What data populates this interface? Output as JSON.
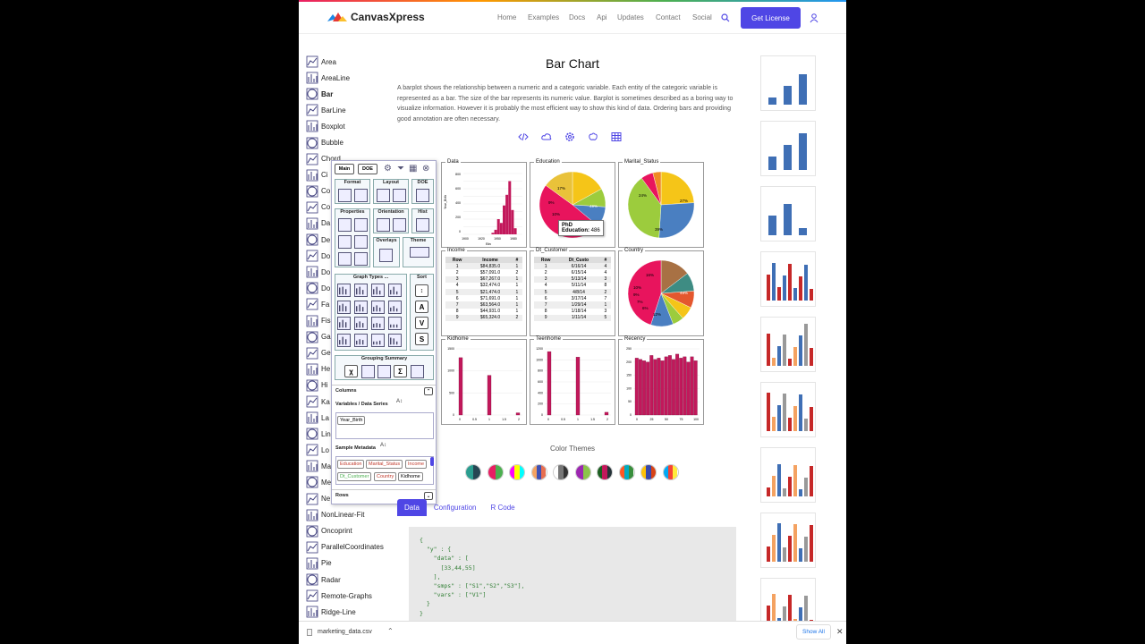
{
  "nav": {
    "logo_text": "CanvasXpress",
    "links": [
      "Home",
      "Examples",
      "Docs",
      "Api",
      "Updates",
      "Contact",
      "Social"
    ],
    "cta": "Get License"
  },
  "sidebar": {
    "items": [
      "Area",
      "AreaLine",
      "Bar",
      "BarLine",
      "Boxplot",
      "Bubble",
      "Chord",
      "Ci",
      "Co",
      "Co",
      "Da",
      "De",
      "Do",
      "Do",
      "Do",
      "Fa",
      "Fis",
      "Ga",
      "Ge",
      "He",
      "Hi",
      "Ka",
      "La",
      "Lin",
      "Lo",
      "Ma",
      "Me",
      "Ne",
      "NonLinear-Fit",
      "Oncoprint",
      "ParallelCoordinates",
      "Pie",
      "Radar",
      "Remote-Graphs",
      "Ridge-Line"
    ],
    "active": "Bar"
  },
  "main": {
    "title": "Bar Chart",
    "description": "A barplot shows the relationship between a numeric and a categoric variable. Each entity of the categoric variable is represented as a bar. The size of the bar represents its numeric value. Barplot is sometimes described as a boring way to visualize information. However it is probably the most efficient way to show this kind of data. Ordering bars and providing good annotation are often necessary.",
    "icons": [
      "code-icon",
      "cloud-icon",
      "gear-icon",
      "brain-icon",
      "table-icon"
    ]
  },
  "dashboard": {
    "panels": [
      {
        "title": "Data"
      },
      {
        "title": "Education"
      },
      {
        "title": "Marital_Status"
      },
      {
        "title": "Income"
      },
      {
        "title": "Dt_Customer"
      },
      {
        "title": "Country"
      },
      {
        "title": "Kidhome"
      },
      {
        "title": "Teenhome"
      },
      {
        "title": "Recency"
      }
    ],
    "data_hist": {
      "xlabel": "Bin",
      "ylabel": "Year_Birth",
      "xticks": [
        "1900",
        "1920",
        "1950",
        "1980"
      ],
      "yticks": [
        "800",
        "600",
        "400",
        "200",
        "0"
      ]
    },
    "pie_labels": {
      "education": [
        "17%",
        "9%",
        "10%",
        "49%"
      ],
      "marital": [
        "24%",
        "27%",
        "39%"
      ],
      "country": [
        "16%",
        "10%",
        "9%",
        "7%",
        "6%",
        "12%",
        "49%"
      ]
    },
    "income_table": {
      "headers": [
        "Row",
        "Income",
        "#"
      ],
      "rows": [
        [
          "1",
          "$84,835.0",
          "1"
        ],
        [
          "2",
          "$57,091.0",
          "2"
        ],
        [
          "3",
          "$67,267.0",
          "1"
        ],
        [
          "4",
          "$32,474.0",
          "1"
        ],
        [
          "5",
          "$21,474.0",
          "1"
        ],
        [
          "6",
          "$71,691.0",
          "1"
        ],
        [
          "7",
          "$63,564.0",
          "1"
        ],
        [
          "8",
          "$44,931.0",
          "1"
        ],
        [
          "9",
          "$65,324.0",
          "2"
        ]
      ]
    },
    "dt_table": {
      "headers": [
        "Row",
        "Dt_Custo",
        "#"
      ],
      "rows": [
        [
          "1",
          "6/16/14",
          "4"
        ],
        [
          "2",
          "6/15/14",
          "4"
        ],
        [
          "3",
          "5/13/14",
          "3"
        ],
        [
          "4",
          "5/11/14",
          "8"
        ],
        [
          "5",
          "4/8/14",
          "2"
        ],
        [
          "6",
          "3/17/14",
          "7"
        ],
        [
          "7",
          "1/29/14",
          "1"
        ],
        [
          "8",
          "1/18/14",
          "3"
        ],
        [
          "9",
          "1/11/14",
          "5"
        ]
      ]
    },
    "kid_ticks": {
      "x": [
        "0",
        "0.5",
        "1",
        "1.5",
        "2"
      ],
      "y": [
        "1500",
        "1000",
        "500",
        "0"
      ]
    },
    "teen_ticks": {
      "x": [
        "0",
        "0.5",
        "1",
        "1.5",
        "2"
      ],
      "y": [
        "1200",
        "1000",
        "800",
        "600",
        "400",
        "200",
        "0"
      ]
    },
    "recency_ticks": {
      "x": [
        "0",
        "25",
        "50",
        "75",
        "100"
      ],
      "y": [
        "250",
        "200",
        "150",
        "100",
        "50",
        "0"
      ]
    },
    "tooltip": {
      "line1": "PhD",
      "line2_label": "Education:",
      "line2_value": "486"
    }
  },
  "panel": {
    "tabs": [
      "Main",
      "DOE"
    ],
    "groups": [
      "Format",
      "Layout",
      "DOE",
      "Properties",
      "Orientation",
      "Hist",
      "Overlays",
      "Theme",
      "Graph Types ...",
      "Sort",
      "Grouping Summary"
    ],
    "sort_letters": [
      "A",
      "V",
      "S"
    ],
    "columns_label": "Columns",
    "variables_label": "Variables / Data Series",
    "variable_chip": "Year_Birth",
    "sample_metadata_label": "Sample Metadata",
    "metadata_chips": [
      "Education",
      "Marital_Status",
      "Income",
      "Dt_Customer",
      "Country",
      "Kidhome"
    ],
    "rows_label": "Rows"
  },
  "themes": {
    "label": "Color Themes",
    "swatches": [
      [
        "#2a9d8f",
        "#264653"
      ],
      [
        "#e91e63",
        "#4caf50"
      ],
      [
        "#ff00ff",
        "#ffff00",
        "#00ffff"
      ],
      [
        "#f4a261",
        "#3f51b5",
        "#e76f51"
      ],
      [
        "#ffffff",
        "#777777",
        "#333333"
      ],
      [
        "#9c27b0",
        "#8bc34a"
      ],
      [
        "#1b5e20",
        "#c2185b",
        "#263238"
      ],
      [
        "#ff5722",
        "#00acc1",
        "#388e3c"
      ],
      [
        "#ffc107",
        "#3949ab",
        "#d84315"
      ],
      [
        "#03a9f4",
        "#f44336",
        "#ffeb3b"
      ]
    ]
  },
  "bottom_tabs": {
    "items": [
      "Data",
      "Configuration",
      "R Code"
    ],
    "active": "Data"
  },
  "code": "{\n  \"y\" : {\n    \"data\" : [\n      [33,44,55]\n    ],\n    \"smps\" : [\"S1\",\"S2\",\"S3\"],\n    \"vars\" : [\"V1\"]\n  }\n}",
  "download": {
    "file": "marketing_data.csv",
    "show_all": "Show All"
  },
  "chart_data": [
    {
      "type": "bar",
      "panel": "Data",
      "categories": [
        "1900",
        "1920",
        "1950",
        "1980"
      ],
      "x": [
        1940,
        1945,
        1950,
        1955,
        1960,
        1965,
        1970,
        1975,
        1980
      ],
      "values": [
        20,
        60,
        200,
        150,
        380,
        520,
        700,
        320,
        80
      ],
      "ylim": [
        0,
        800
      ],
      "xlabel": "Bin",
      "ylabel": "Year_Birth"
    },
    {
      "type": "pie",
      "panel": "Education",
      "values": [
        17,
        9,
        10,
        49,
        15
      ],
      "colors": [
        "#f5c518",
        "#9ccc3d",
        "#4a7fc1",
        "#e8145d",
        "#e9c23a"
      ]
    },
    {
      "type": "pie",
      "panel": "Marital_Status",
      "values": [
        24,
        27,
        39,
        6,
        4
      ],
      "colors": [
        "#f5c518",
        "#4a7fc1",
        "#9ccc3d",
        "#e8145d",
        "#f08a24"
      ]
    },
    {
      "type": "pie",
      "panel": "Country",
      "values": [
        16,
        10,
        9,
        7,
        6,
        12,
        49
      ],
      "colors": [
        "#a87144",
        "#3e8c83",
        "#e4572e",
        "#f5c518",
        "#9ccc3d",
        "#4a7fc1",
        "#e8145d"
      ]
    },
    {
      "type": "bar",
      "panel": "Kidhome",
      "x": [
        0,
        1,
        2
      ],
      "values": [
        1300,
        900,
        50
      ],
      "ylim": [
        0,
        1500
      ]
    },
    {
      "type": "bar",
      "panel": "Teenhome",
      "x": [
        0,
        1,
        2
      ],
      "values": [
        1150,
        1050,
        50
      ],
      "ylim": [
        0,
        1200
      ]
    },
    {
      "type": "bar",
      "panel": "Recency",
      "values": [
        215,
        210,
        205,
        200,
        225,
        210,
        215,
        205,
        220,
        225,
        210,
        230,
        215,
        220,
        200,
        220,
        205
      ],
      "ylim": [
        0,
        250
      ]
    }
  ]
}
